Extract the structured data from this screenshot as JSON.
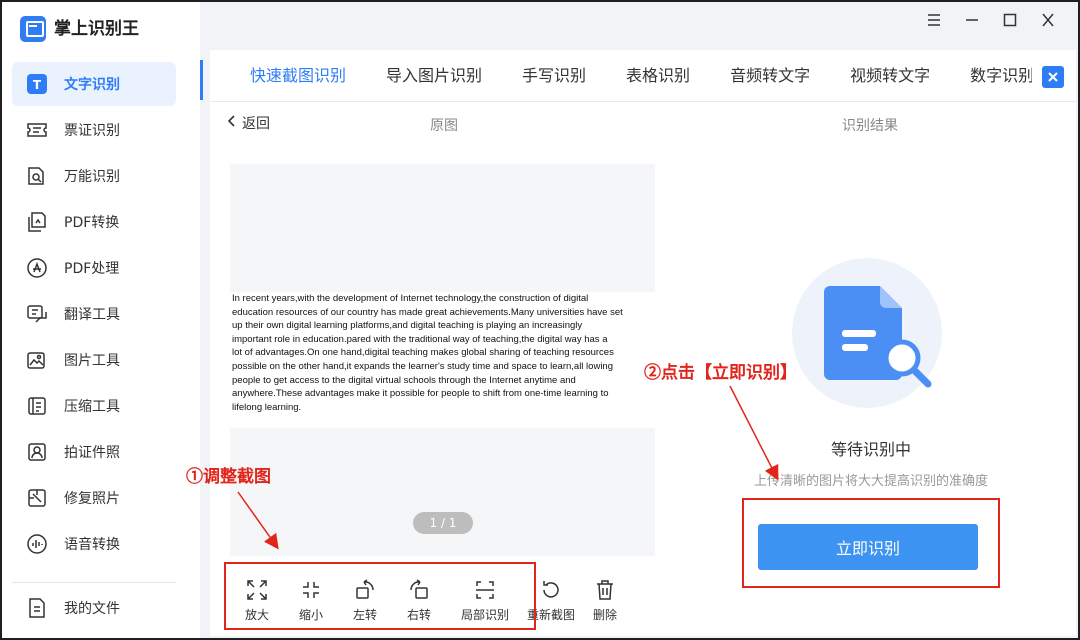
{
  "app": {
    "title": "掌上识别王"
  },
  "sidebar": {
    "items": [
      {
        "label": "文字识别",
        "icon": "text-recognition-icon",
        "active": true
      },
      {
        "label": "票证识别",
        "icon": "ticket-icon"
      },
      {
        "label": "万能识别",
        "icon": "universal-scan-icon"
      },
      {
        "label": "PDF转换",
        "icon": "pdf-convert-icon"
      },
      {
        "label": "PDF处理",
        "icon": "pdf-process-icon"
      },
      {
        "label": "翻译工具",
        "icon": "translate-icon"
      },
      {
        "label": "图片工具",
        "icon": "image-tool-icon"
      },
      {
        "label": "压缩工具",
        "icon": "compress-icon"
      },
      {
        "label": "拍证件照",
        "icon": "id-photo-icon"
      },
      {
        "label": "修复照片",
        "icon": "repair-photo-icon"
      },
      {
        "label": "语音转换",
        "icon": "voice-convert-icon"
      }
    ],
    "my_files": "我的文件"
  },
  "tabs": [
    {
      "label": "快速截图识别",
      "active": true
    },
    {
      "label": "导入图片识别"
    },
    {
      "label": "手写识别"
    },
    {
      "label": "表格识别"
    },
    {
      "label": "音频转文字"
    },
    {
      "label": "视频转文字"
    },
    {
      "label": "数字识别"
    }
  ],
  "subbar": {
    "back": "返回",
    "original": "原图",
    "result": "识别结果"
  },
  "preview": {
    "lines": [
      "In recent years,with the development of Internet technology,the construction of digital",
      "education resources of our country has made great achievements.Many universities have set",
      "up their own digital learning platforms,and digital teaching is playing an increasingly",
      "important role in education.pared with the traditional way of teaching,the digital way has a",
      "lot of advantages.On one hand,digital teaching makes global sharing of teaching resources",
      "possible on the other hand,it expands the learner's study time and space to learn,all lowing",
      "people to get access to the digital virtual schools through the Internet anytime and",
      "anywhere.These advantages make it possible for people to shift from one-time learning to",
      "lifelong learning."
    ],
    "page": "1 / 1"
  },
  "toolbar": {
    "zoom_in": "放大",
    "zoom_out": "缩小",
    "rotate_left": "左转",
    "rotate_right": "右转",
    "partial": "局部识别",
    "recapture": "重新截图",
    "delete": "删除"
  },
  "result": {
    "status": "等待识别中",
    "hint": "上传清晰的图片将大大提高识别的准确度",
    "button": "立即识别"
  },
  "annotations": {
    "step1": "①调整截图",
    "step2": "②点击【立即识别】"
  },
  "colors": {
    "accent": "#2f7df6",
    "annotation": "#e1251b"
  }
}
